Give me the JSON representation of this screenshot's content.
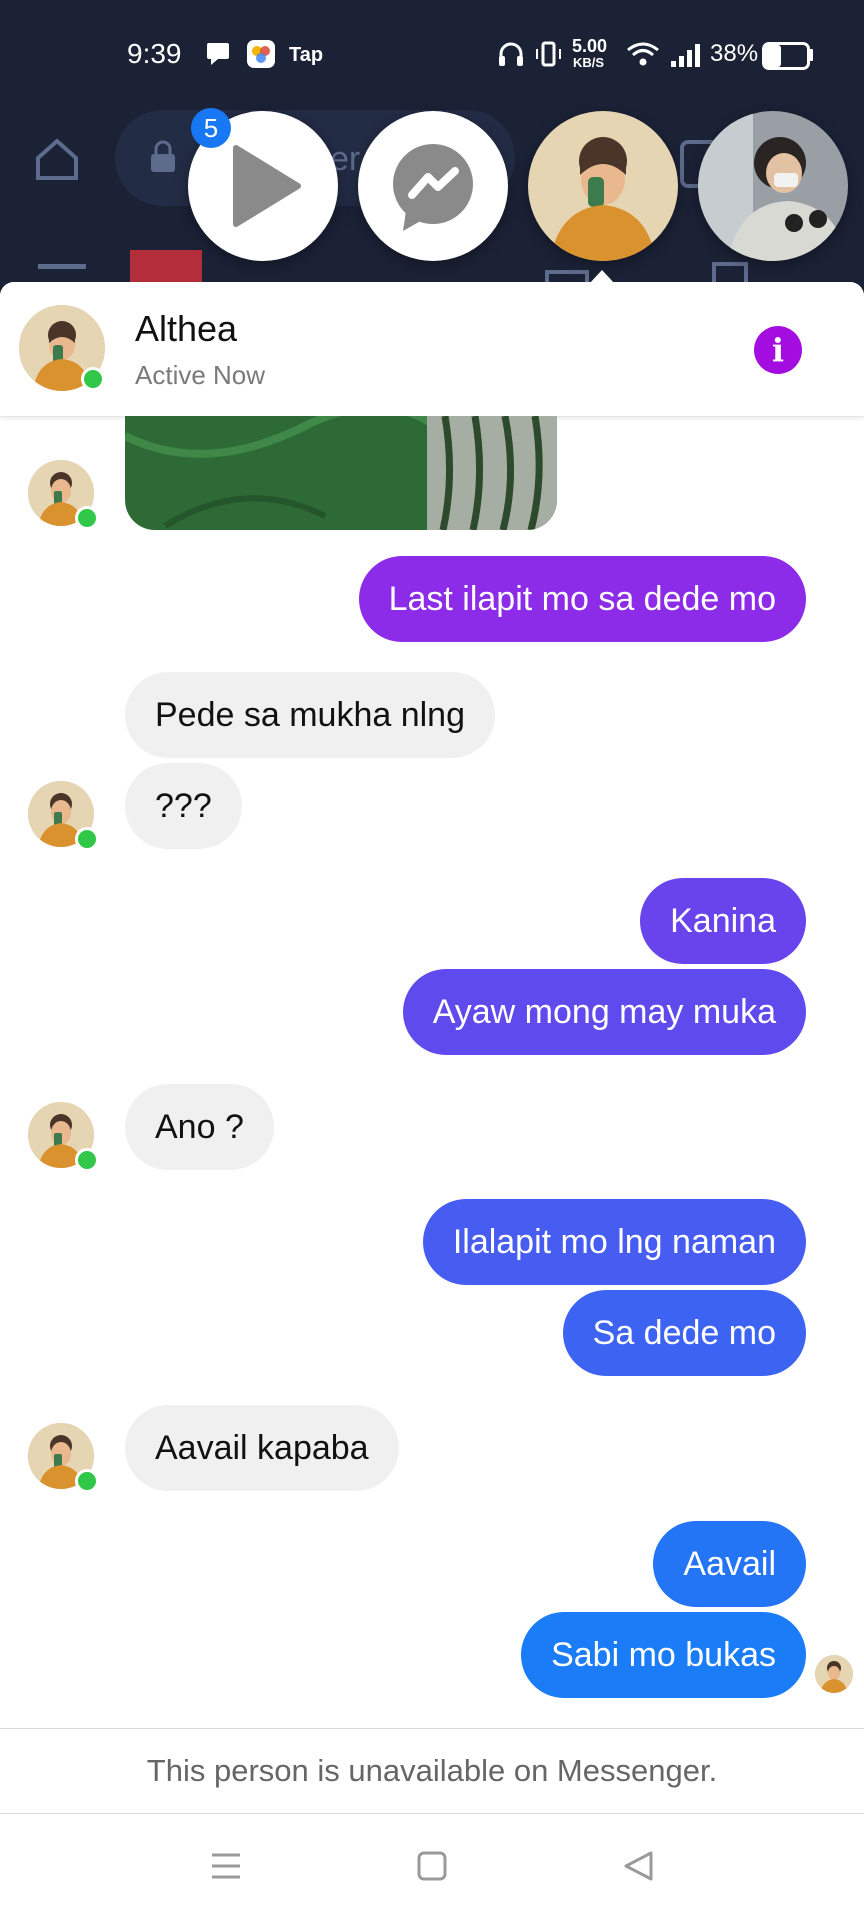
{
  "status_bar": {
    "time": "9:39",
    "notification_app_label": "Tap",
    "network_speed_value": "5.00",
    "network_speed_unit": "KB/S",
    "battery_percent": "38%",
    "battery_level": 0.38,
    "icons": [
      "message-icon",
      "photos-app-icon",
      "headphones-icon",
      "vibrate-icon",
      "wifi-icon",
      "signal-icon",
      "battery-icon"
    ]
  },
  "background_app": {
    "search_text_fragment": "er",
    "icons": [
      "home-icon",
      "lock-icon",
      "menu-icon",
      "flag-icon",
      "mail-icon",
      "document-icon"
    ]
  },
  "chat_heads": {
    "video_badge_count": "5",
    "items": [
      "video-play-head",
      "messenger-head",
      "althea-head",
      "other-contact-head"
    ]
  },
  "chat": {
    "contact_name": "Althea",
    "contact_status": "Active Now",
    "messages": [
      {
        "type": "incoming",
        "text": "Pede sa mukha nlng"
      },
      {
        "type": "incoming",
        "text": "???"
      },
      {
        "type": "outgoing",
        "text": "Last ilapit mo sa dede mo"
      },
      {
        "type": "outgoing",
        "text": "Kanina"
      },
      {
        "type": "outgoing",
        "text": "Ayaw mong may muka"
      },
      {
        "type": "incoming",
        "text": "Ano ?"
      },
      {
        "type": "outgoing",
        "text": "Ilalapit mo lng naman"
      },
      {
        "type": "outgoing",
        "text": "Sa dede mo"
      },
      {
        "type": "incoming",
        "text": "Aavail kapaba"
      },
      {
        "type": "outgoing",
        "text": "Aavail"
      },
      {
        "type": "outgoing",
        "text": "Sabi mo bukas"
      }
    ],
    "unavailable_notice": "This person is unavailable on Messenger."
  },
  "colors": {
    "accent_purple": "#a30ddf",
    "gradient_purple": "#8c2be8",
    "gradient_blue": "#1a7cf6",
    "online_green": "#31c84a",
    "badge_blue": "#1877f2"
  },
  "nav_bar": {
    "icons": [
      "recent-apps-icon",
      "home-square-icon",
      "back-triangle-icon"
    ]
  }
}
